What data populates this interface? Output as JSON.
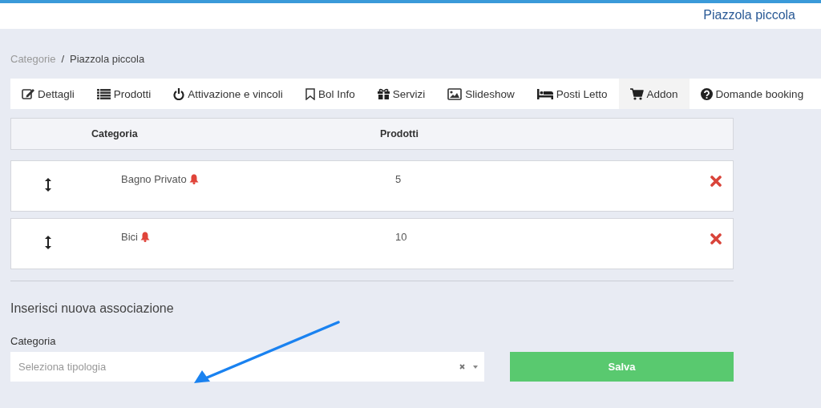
{
  "header": {
    "title": "Piazzola piccola"
  },
  "breadcrumb_separator": "/",
  "breadcrumb": [
    {
      "label": "Categorie",
      "current": false
    },
    {
      "label": "Piazzola piccola",
      "current": true
    }
  ],
  "tabs": [
    {
      "label": "Dettagli",
      "selected": false
    },
    {
      "label": "Prodotti",
      "selected": false
    },
    {
      "label": "Attivazione e vincoli",
      "selected": false
    },
    {
      "label": "Bol Info",
      "selected": false
    },
    {
      "label": "Servizi",
      "selected": false
    },
    {
      "label": "Slideshow",
      "selected": false
    },
    {
      "label": "Posti Letto",
      "selected": false
    },
    {
      "label": "Addon",
      "selected": true
    },
    {
      "label": "Domande booking",
      "selected": false
    }
  ],
  "table": {
    "columns": [
      "Categoria",
      "Prodotti"
    ],
    "rows": [
      {
        "categoria": "Bagno Privato",
        "prodotti": "5"
      },
      {
        "categoria": "Bici",
        "prodotti": "10"
      }
    ]
  },
  "form": {
    "heading": "Inserisci nuova associazione",
    "label": "Categoria",
    "placeholder": "Seleziona tipologia",
    "button": "Salva"
  }
}
